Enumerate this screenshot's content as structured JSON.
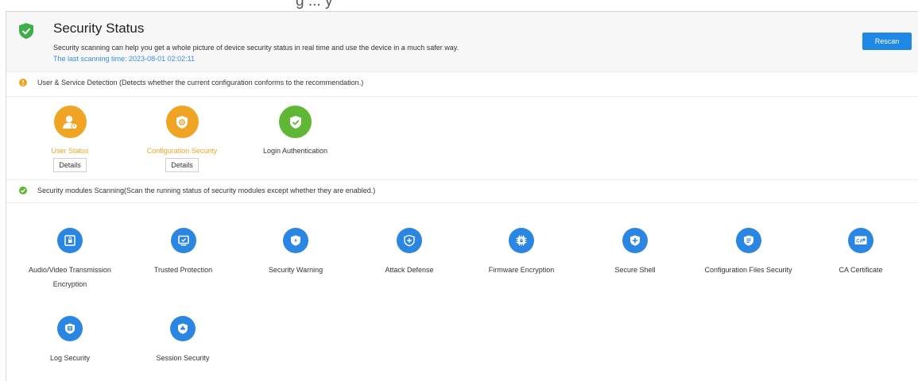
{
  "colors": {
    "warning": "#f0a424",
    "success": "#5fb735",
    "module_blue": "#2a86e0",
    "link_blue": "#3a8ee6",
    "button_blue": "#1e88e5"
  },
  "top_partial_text": "g   ...   y",
  "header": {
    "icon": "shield-check-icon",
    "title": "Security Status",
    "description": "Security scanning can help you get a whole picture of device security status in real time and use the device in a much safer way.",
    "last_scan": "The last scanning time: 2023-08-01 02:02:11",
    "rescan_label": "Rescan"
  },
  "user_service": {
    "heading": "User & Service Detection (Detects whether the current configuration conforms to the recommendation.)",
    "items": [
      {
        "label": "User Status",
        "icon": "user-lock-icon",
        "status": "warning",
        "details_label": "Details"
      },
      {
        "label": "Configuration Security",
        "icon": "gear-shield-icon",
        "status": "warning",
        "details_label": "Details"
      },
      {
        "label": "Login Authentication",
        "icon": "shield-check-icon",
        "status": "ok"
      }
    ]
  },
  "modules": {
    "heading": "Security modules Scanning(Scan the running status of security modules except whether they are enabled.)",
    "items": [
      {
        "label_line1": "Audio/Video Transmission",
        "label_line2": "Encryption",
        "icon": "encrypted-video-icon"
      },
      {
        "label_line1": "Trusted Protection",
        "icon": "monitor-check-icon"
      },
      {
        "label_line1": "Security Warning",
        "icon": "shield-bolt-icon"
      },
      {
        "label_line1": "Attack Defense",
        "icon": "shield-plus-icon"
      },
      {
        "label_line1": "Firmware Encryption",
        "icon": "chip-lock-icon"
      },
      {
        "label_line1": "Secure Shell",
        "icon": "shield-cross-icon"
      },
      {
        "label_line1": "Configuration Files Security",
        "icon": "file-shield-icon"
      },
      {
        "label_line1": "CA Certificate",
        "icon": "certificate-icon"
      },
      {
        "label_line1": "Log Security",
        "icon": "log-shield-icon"
      },
      {
        "label_line1": "Session Security",
        "icon": "session-shield-icon"
      }
    ]
  }
}
